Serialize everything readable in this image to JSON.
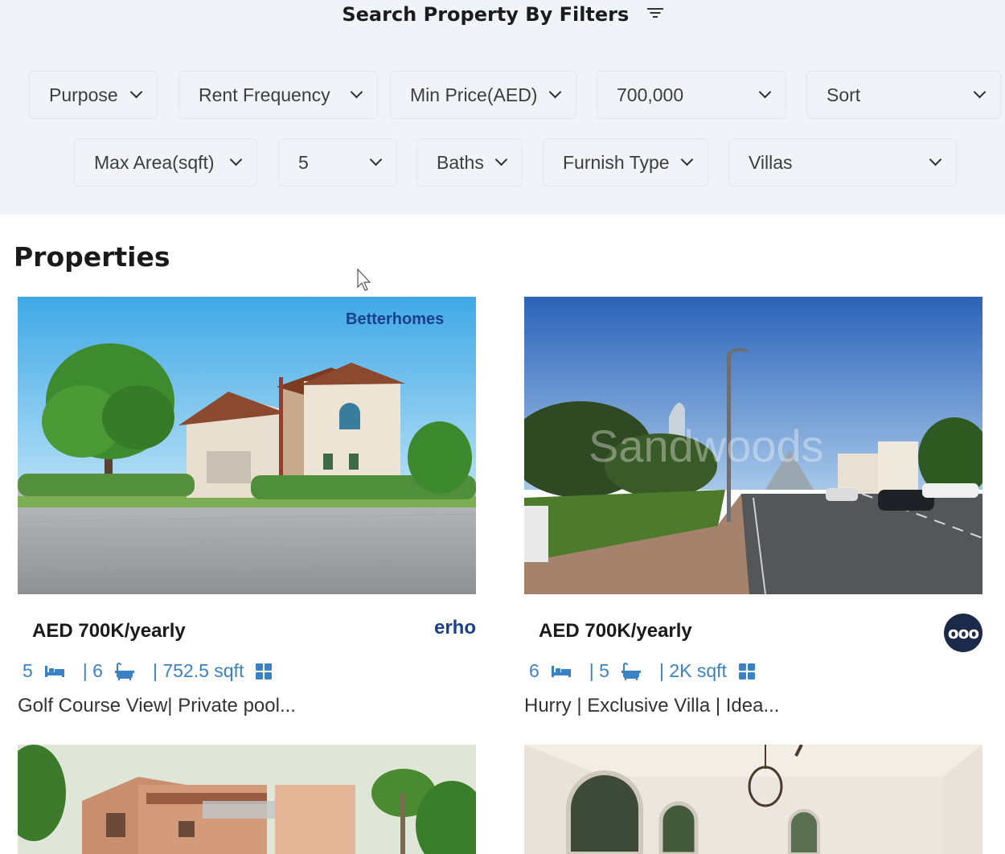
{
  "filters": {
    "title": "Search Property By Filters",
    "row1": [
      {
        "label": "Purpose"
      },
      {
        "label": "Rent Frequency"
      },
      {
        "label": "Min Price(AED)"
      },
      {
        "label": "700,000"
      },
      {
        "label": "Sort"
      }
    ],
    "row2": [
      {
        "label": "Max Area(sqft)"
      },
      {
        "label": "5"
      },
      {
        "label": "Baths"
      },
      {
        "label": "Furnish Type"
      },
      {
        "label": "Villas"
      }
    ]
  },
  "section": {
    "title": "Properties"
  },
  "properties": [
    {
      "price": "AED 700K/yearly",
      "agency": "erho",
      "rooms": "5",
      "baths": "| 6",
      "area": "| 752.5 sqft",
      "title": "Golf Course View| Private pool...",
      "image_brand": "Betterhomes"
    },
    {
      "price": "AED 700K/yearly",
      "agency": "ooo",
      "rooms": "6",
      "baths": "| 5",
      "area": "| 2K sqft",
      "title": "Hurry | Exclusive Villa | Idea...",
      "image_watermark": "Sandwoods"
    }
  ],
  "colors": {
    "accent": "#3b82c4",
    "filter_bg": "#f0f4f9"
  }
}
